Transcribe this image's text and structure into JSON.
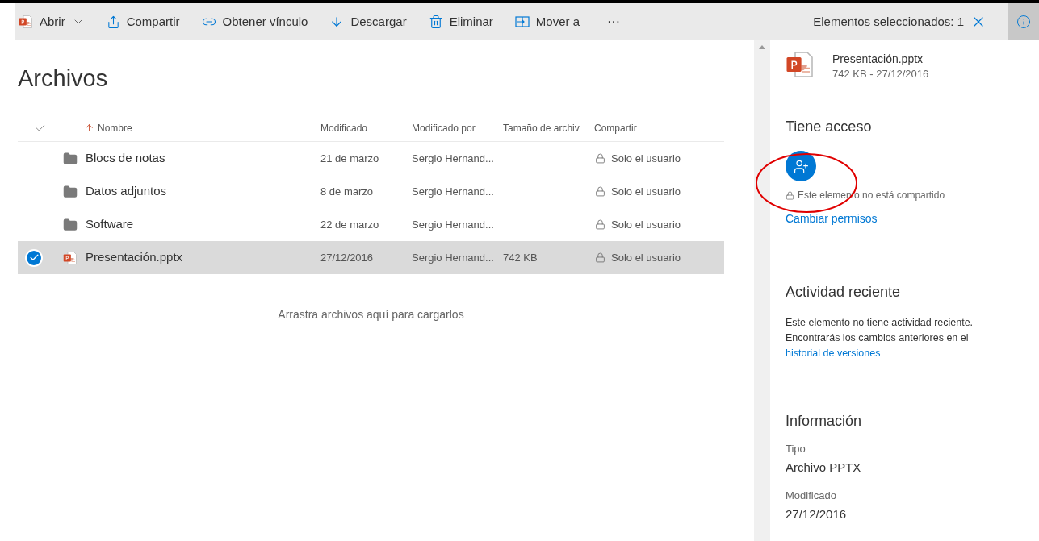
{
  "toolbar": {
    "commands": [
      {
        "label": "Abrir",
        "has_menu": true
      },
      {
        "label": "Compartir",
        "has_menu": false
      },
      {
        "label": "Obtener vínculo",
        "has_menu": false
      },
      {
        "label": "Descargar",
        "has_menu": false
      },
      {
        "label": "Eliminar",
        "has_menu": false
      },
      {
        "label": "Mover a",
        "has_menu": false
      }
    ],
    "more": "···",
    "selection": "Elementos seleccionados: 1"
  },
  "main": {
    "title": "Archivos",
    "table": {
      "columns": [
        {
          "label": "Nombre",
          "sorted": true
        },
        {
          "label": "Modificado",
          "sorted": false
        },
        {
          "label": "Modificado por",
          "sorted": false
        },
        {
          "label": "Tamaño de archiv",
          "sorted": false
        },
        {
          "label": "Compartir",
          "sorted": false
        }
      ],
      "rows": [
        {
          "kind": "folder",
          "name": "Blocs de notas",
          "modified": "21 de marzo",
          "modified_by": "Sergio Hernand...",
          "size": null,
          "sharing": "Solo el usuario",
          "selected": false
        },
        {
          "kind": "folder",
          "name": "Datos adjuntos",
          "modified": "8 de marzo",
          "modified_by": "Sergio Hernand...",
          "size": null,
          "sharing": "Solo el usuario",
          "selected": false
        },
        {
          "kind": "folder",
          "name": "Software",
          "modified": "22 de marzo",
          "modified_by": "Sergio Hernand...",
          "size": null,
          "sharing": "Solo el usuario",
          "selected": false
        },
        {
          "kind": "pptx",
          "name": "Presentación.pptx",
          "modified": "27/12/2016",
          "modified_by": "Sergio Hernand...",
          "size": "742 KB",
          "sharing": "Solo el usuario",
          "selected": true
        }
      ]
    },
    "drop_hint": "Arrastra archivos aquí para cargarlos"
  },
  "details": {
    "file_name": "Presentación.pptx",
    "file_meta": "742 KB - 27/12/2016",
    "access": {
      "heading": "Tiene acceso",
      "status": "Este elemento no está compartido",
      "link": "Cambiar permisos"
    },
    "activity": {
      "heading": "Actividad reciente",
      "text": "Este elemento no tiene actividad reciente. Encontrarás los cambios anteriores en el",
      "link": "historial de versiones"
    },
    "info": {
      "heading": "Información",
      "fields": [
        {
          "label": "Tipo",
          "value": "Archivo PPTX"
        },
        {
          "label": "Modificado",
          "value": "27/12/2016"
        }
      ]
    }
  }
}
